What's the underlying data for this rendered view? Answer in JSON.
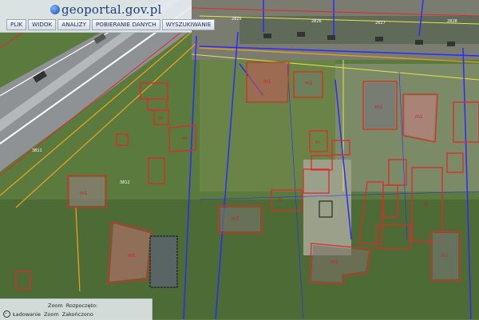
{
  "app": {
    "logo_main": "geoportal",
    "logo_domain": ".gov.pl"
  },
  "menu": {
    "items": [
      "PLIK",
      "WIDOK",
      "ANALIZY",
      "POBIERANIE DANYCH",
      "WYSZUKIWANIE"
    ]
  },
  "status": {
    "zoom_label": "Zoom",
    "start_label": "Rozpoczęto:",
    "loading_label": "Ładowanie",
    "end_label": "Zakończono"
  },
  "colors": {
    "parcel_line": "#2a2aff",
    "building_outline": "#e0282b",
    "utility_line": "#e8a020",
    "road_edge": "#ffffff"
  }
}
